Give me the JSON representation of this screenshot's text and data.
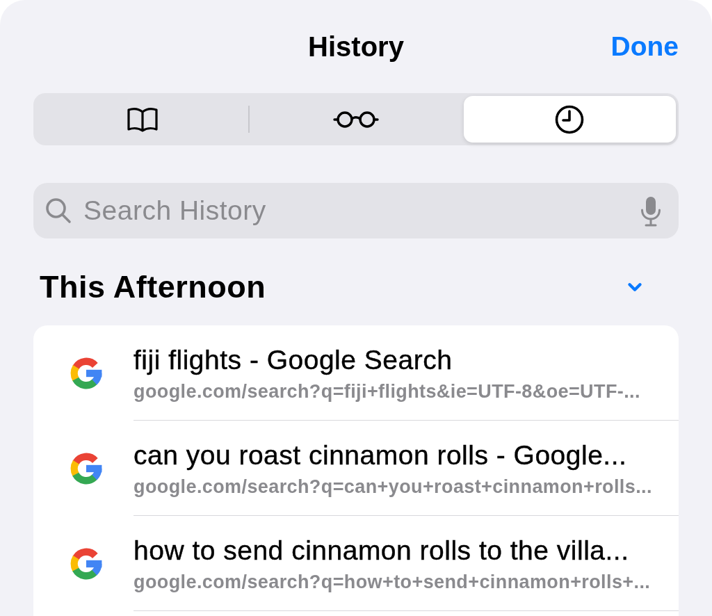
{
  "header": {
    "title": "History",
    "done": "Done"
  },
  "segments": [
    {
      "kind": "book",
      "selected": false
    },
    {
      "kind": "glasses",
      "selected": false
    },
    {
      "kind": "clock",
      "selected": true
    }
  ],
  "search": {
    "placeholder": "Search History"
  },
  "section": {
    "title": "This Afternoon",
    "expanded": true
  },
  "items": [
    {
      "title": "fiji flights - Google Search",
      "url": "google.com/search?q=fiji+flights&ie=UTF-8&oe=UTF-..."
    },
    {
      "title": "can you roast cinnamon rolls - Google...",
      "url": "google.com/search?q=can+you+roast+cinnamon+rolls..."
    },
    {
      "title": "how to send cinnamon rolls to the villa...",
      "url": "google.com/search?q=how+to+send+cinnamon+rolls+..."
    }
  ]
}
